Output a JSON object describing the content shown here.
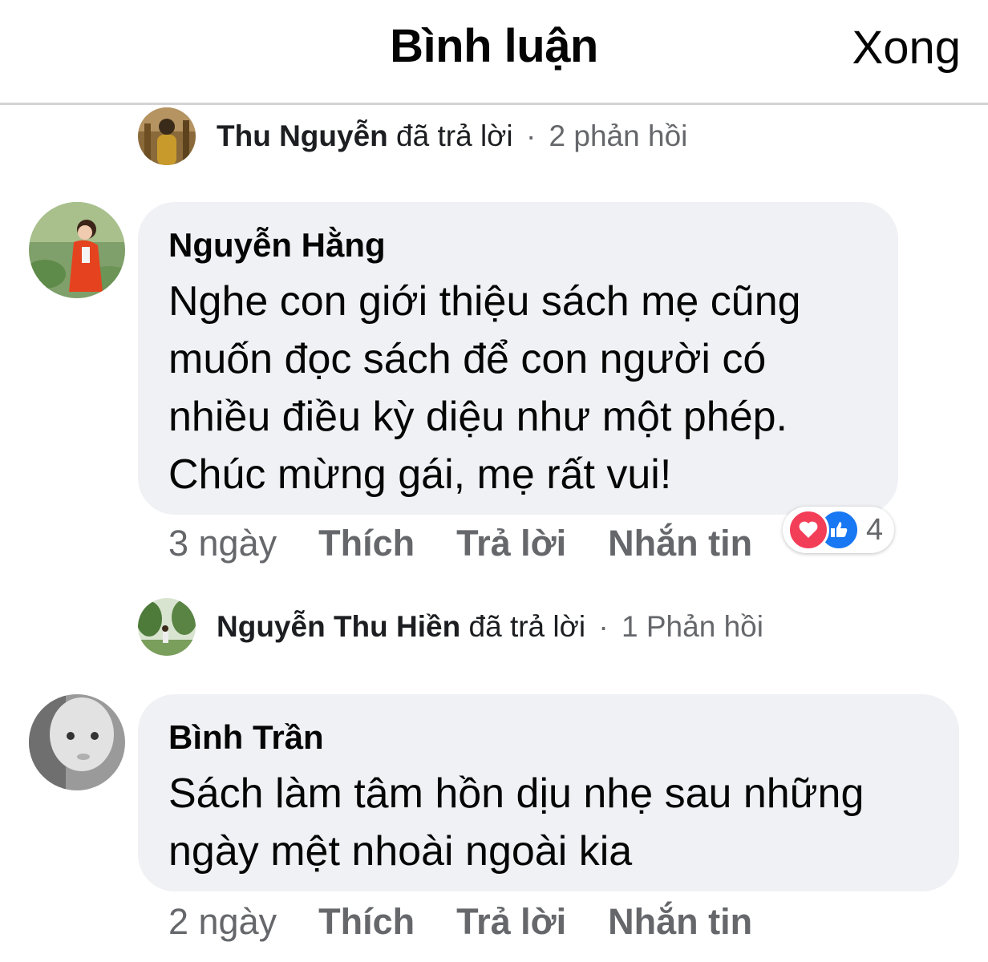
{
  "header": {
    "title": "Bình luận",
    "done_label": "Xong"
  },
  "reply_summary_1": {
    "name": "Thu Nguyễn",
    "action": "đã trả lời",
    "separator": "·",
    "count": "2 phản hồi"
  },
  "comment_1": {
    "author": "Nguyễn Hằng",
    "lines": [
      "Nghe con giới thiệu sách mẹ cũng",
      "muốn đọc sách để con người có",
      "nhiều điều kỳ diệu như một phép.",
      "Chúc mừng gái, mẹ rất vui!"
    ],
    "time": "3 ngày",
    "like_label": "Thích",
    "reply_label": "Trả lời",
    "message_label": "Nhắn tin",
    "reactions": {
      "icons": [
        "heart-icon",
        "like-icon"
      ],
      "count": "4",
      "colors": {
        "heart": "#f33e58",
        "like": "#1877f2"
      }
    }
  },
  "reply_summary_2": {
    "name": "Nguyễn Thu Hiền",
    "action": "đã trả lời",
    "separator": "·",
    "count": "1 Phản hồi"
  },
  "comment_2": {
    "author": "Bình Trần",
    "lines": [
      "Sách làm tâm hồn dịu nhẹ sau những",
      "ngày mệt nhoài ngoài kia"
    ],
    "time": "2 ngày",
    "like_label": "Thích",
    "reply_label": "Trả lời",
    "message_label": "Nhắn tin"
  }
}
